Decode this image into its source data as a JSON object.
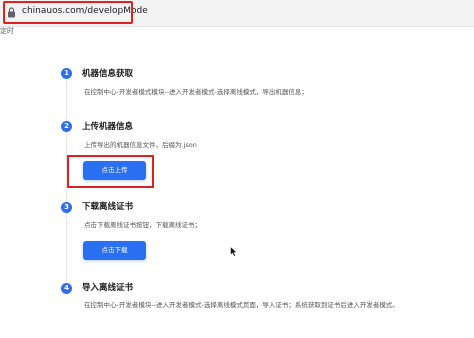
{
  "browser": {
    "url": "chinauos.com/developMode"
  },
  "cut_label": "定时",
  "steps": [
    {
      "number": "1",
      "title": "机器信息获取",
      "description": "在控制中心-开发者模式模块--进入开发者模式-选择离线模式，导出机器信息；"
    },
    {
      "number": "2",
      "title": "上传机器信息",
      "description": "上传导出的机器信息文件，后缀为.json",
      "button_label": "点击上传"
    },
    {
      "number": "3",
      "title": "下载离线证书",
      "description": "点击下载离线证书按钮，下载离线证书；",
      "button_label": "点击下载"
    },
    {
      "number": "4",
      "title": "导入离线证书",
      "description": "在控制中心-开发者模块--进入开发者模式-选择离线模式页面，导入证书；系统获取到证书后进入开发者模式。"
    }
  ],
  "colors": {
    "accent": "#2b6ff2",
    "highlight": "#e0211f"
  }
}
